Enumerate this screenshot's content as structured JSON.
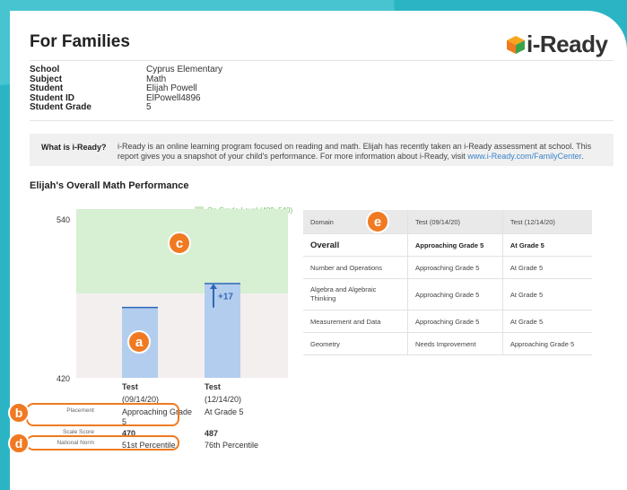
{
  "header": {
    "title": "For Families",
    "logo_text": "i-Ready"
  },
  "info": {
    "rows": [
      {
        "label": "School",
        "value": "Cyprus Elementary"
      },
      {
        "label": "Subject",
        "value": "Math"
      },
      {
        "label": "Student",
        "value": "Elijah Powell"
      },
      {
        "label": "Student ID",
        "value": "ElPowell4896"
      },
      {
        "label": "Student Grade",
        "value": "5"
      }
    ]
  },
  "about": {
    "label": "What is i-Ready?",
    "text": "i-Ready is an online learning program focused on reading and math. Elijah has recently taken an i-Ready assessment at school. This report gives you a snapshot of your child's performance. For more information about i-Ready, visit ",
    "link": "www.i-Ready.com/FamilyCenter",
    "text_end": "."
  },
  "performance": {
    "title": "Elijah's Overall Math Performance",
    "legend": "On Grade Level (480–540)",
    "y_max_label": "540",
    "y_min_label": "420",
    "growth_label": "+17",
    "row_labels": {
      "placement": "Placement",
      "scale_score": "Scale Score",
      "national_norm": "National Norm"
    },
    "tests": [
      {
        "name": "Test",
        "date": "(09/14/20)",
        "placement": "Approaching Grade 5",
        "scale_score": "470",
        "national_norm": "51st Percentile"
      },
      {
        "name": "Test",
        "date": "(12/14/20)",
        "placement": "At Grade 5",
        "scale_score": "487",
        "national_norm": "76th Percentile"
      }
    ]
  },
  "chart_data": {
    "type": "bar",
    "categories": [
      "Test (09/14/20)",
      "Test (12/14/20)"
    ],
    "values": [
      470,
      487
    ],
    "ylim": [
      420,
      540
    ],
    "band": {
      "label": "On Grade Level (480–540)",
      "range": [
        480,
        540
      ],
      "color": "#d7efd2"
    },
    "colors": {
      "bar": "#b3cdee",
      "bar_top": "#2f67b7",
      "band": "#d7efd2",
      "below": "#f3efef"
    }
  },
  "domains": {
    "headers": [
      "Domain",
      "Test (09/14/20)",
      "Test (12/14/20)"
    ],
    "rows": [
      {
        "domain": "Overall",
        "t1": "Approaching Grade 5",
        "t2": "At Grade 5"
      },
      {
        "domain": "Number and Operations",
        "t1": "Approaching Grade 5",
        "t2": "At Grade 5"
      },
      {
        "domain": "Algebra and Algebraic Thinking",
        "t1": "Approaching Grade 5",
        "t2": "At Grade 5"
      },
      {
        "domain": "Measurement and Data",
        "t1": "Approaching Grade 5",
        "t2": "At Grade 5"
      },
      {
        "domain": "Geometry",
        "t1": "Needs Improvement",
        "t2": "Approaching Grade 5"
      }
    ]
  },
  "markers": {
    "a": "a",
    "b": "b",
    "c": "c",
    "d": "d",
    "e": "e"
  }
}
